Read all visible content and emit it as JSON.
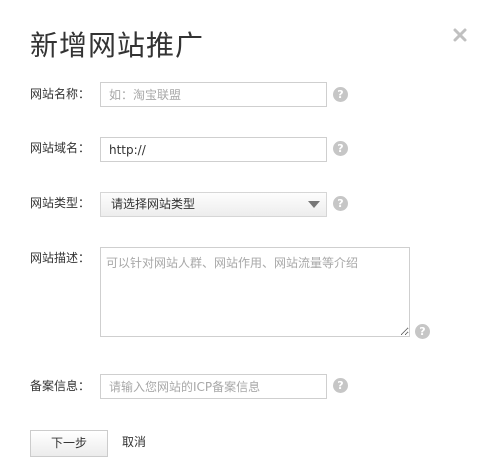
{
  "dialog": {
    "title": "新增网站推广",
    "close_icon": "close-icon"
  },
  "form": {
    "site_name": {
      "label": "网站名称：",
      "placeholder": "如：淘宝联盟",
      "value": ""
    },
    "site_domain": {
      "label": "网站域名：",
      "placeholder": "",
      "value": "http://"
    },
    "site_type": {
      "label": "网站类型：",
      "selected": "请选择网站类型"
    },
    "site_description": {
      "label": "网站描述：",
      "placeholder": "可以针对网站人群、网站作用、网站流量等介绍",
      "value": ""
    },
    "icp_record": {
      "label": "备案信息：",
      "placeholder": "请输入您网站的ICP备案信息",
      "value": ""
    }
  },
  "help_icon": "?",
  "actions": {
    "next_label": "下一步",
    "cancel_label": "取消"
  },
  "colors": {
    "border": "#cfcfcf",
    "help_icon": "#c6c6c6",
    "placeholder": "#a8a8a8",
    "text": "#333333"
  }
}
